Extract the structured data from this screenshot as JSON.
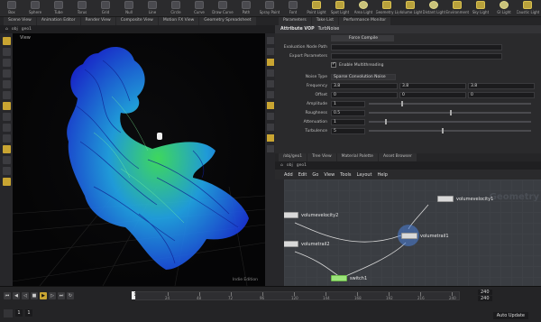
{
  "shelf": {
    "tools": [
      {
        "label": "Box",
        "icon": "box-icon"
      },
      {
        "label": "Sphere",
        "icon": "sphere-icon"
      },
      {
        "label": "Tube",
        "icon": "tube-icon"
      },
      {
        "label": "Torus",
        "icon": "torus-icon"
      },
      {
        "label": "Grid",
        "icon": "grid-icon"
      },
      {
        "label": "Null",
        "icon": "null-icon"
      },
      {
        "label": "Line",
        "icon": "line-icon"
      },
      {
        "label": "Circle",
        "icon": "circle-icon"
      },
      {
        "label": "Curve",
        "icon": "curve-icon"
      },
      {
        "label": "Draw Curve",
        "icon": "draw-curve-icon"
      },
      {
        "label": "Path",
        "icon": "path-icon"
      },
      {
        "label": "Spray Paint",
        "icon": "spray-icon"
      },
      {
        "label": "Font",
        "icon": "font-icon"
      },
      {
        "label": "Point Light",
        "icon": "point-light-icon"
      },
      {
        "label": "Spot Light",
        "icon": "spot-light-icon"
      },
      {
        "label": "Area Light",
        "icon": "area-light-icon"
      },
      {
        "label": "Geometry Light",
        "icon": "geo-light-icon"
      },
      {
        "label": "Volume Light",
        "icon": "volume-light-icon"
      },
      {
        "label": "Distant Light",
        "icon": "distant-light-icon"
      },
      {
        "label": "Environment",
        "icon": "env-light-icon"
      },
      {
        "label": "Sky Light",
        "icon": "sky-light-icon"
      },
      {
        "label": "GI Light",
        "icon": "gi-light-icon"
      },
      {
        "label": "Caustic Light",
        "icon": "caustic-light-icon"
      }
    ]
  },
  "viewer": {
    "tabs": [
      "Scene View",
      "Animation Editor",
      "Render View",
      "Composite View",
      "Motion FX View",
      "Geometry Spreadsheet"
    ],
    "path": [
      "obj",
      "geo1"
    ],
    "label": "View",
    "watermark": "Indie Edition"
  },
  "params": {
    "tabs": [
      "Parameters",
      "Take List",
      "Performance Monitor"
    ],
    "header_type": "Attribute VOP",
    "header_name": "TurbNoise",
    "node_name": "geo1",
    "force_compile": "Force Compile",
    "rows": [
      {
        "label": "Evaluation Node Path",
        "value": ""
      },
      {
        "label": "Export Parameters",
        "value": ""
      }
    ],
    "multithreading": "Enable Multithreading",
    "noise_type_label": "Noise Type",
    "noise_type_value": "Sparse Convolution Noise",
    "frequency_label": "Frequency",
    "frequency_values": [
      "3.8",
      "3.8",
      "3.8"
    ],
    "offset_label": "Offset",
    "offset_values": [
      "0",
      "0",
      "0"
    ],
    "amplitude_label": "Amplitude",
    "amplitude_value": "1",
    "roughness_label": "Roughness",
    "roughness_value": "0.5",
    "attenuation_label": "Attenuation",
    "attenuation_value": "1",
    "turbulence_label": "Turbulence",
    "turbulence_value": "5"
  },
  "network": {
    "tabs": [
      "/obj/geo1",
      "Tree View",
      "Material Palette",
      "Asset Browser"
    ],
    "path": [
      "obj",
      "geo1"
    ],
    "menu": [
      "Add",
      "Edit",
      "Go",
      "View",
      "Tools",
      "Layout",
      "Help"
    ],
    "watermark": "Geometry",
    "nodes": {
      "n1": "volumevelocity1",
      "n2": "volumevelocity2",
      "n3": "volumetrail2",
      "n4": "volumetrail1",
      "n5": "switch1"
    }
  },
  "timeline": {
    "start_frame": "1",
    "current_frame": "1",
    "end_frame_a": "240",
    "end_frame_b": "240",
    "ticks": [
      "24",
      "48",
      "72",
      "96",
      "120",
      "144",
      "168",
      "192",
      "216",
      "240"
    ],
    "auto_update": "Auto Update"
  }
}
